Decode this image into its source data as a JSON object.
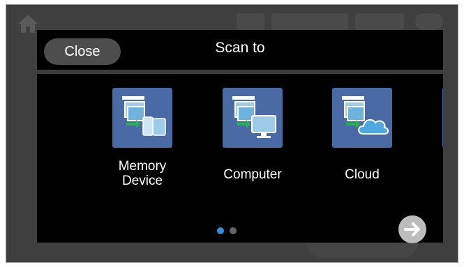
{
  "dialog": {
    "close_label": "Close",
    "title": "Scan to"
  },
  "tiles": [
    {
      "label_line1": "Memory",
      "label_line2": "Device",
      "icon": "memory-device-icon"
    },
    {
      "label": "Computer",
      "icon": "computer-icon"
    },
    {
      "label": "Cloud",
      "icon": "cloud-icon"
    },
    {
      "icon": "partial-next-option-icon"
    }
  ],
  "pagination": {
    "pages": 2,
    "current": 1
  },
  "colors": {
    "tile_bg": "#4a6aa5",
    "active_dot": "#2f8fe0",
    "inactive_dot": "#666666",
    "dialog_bg": "#000000",
    "frame_bg": "#3f3f3f"
  }
}
